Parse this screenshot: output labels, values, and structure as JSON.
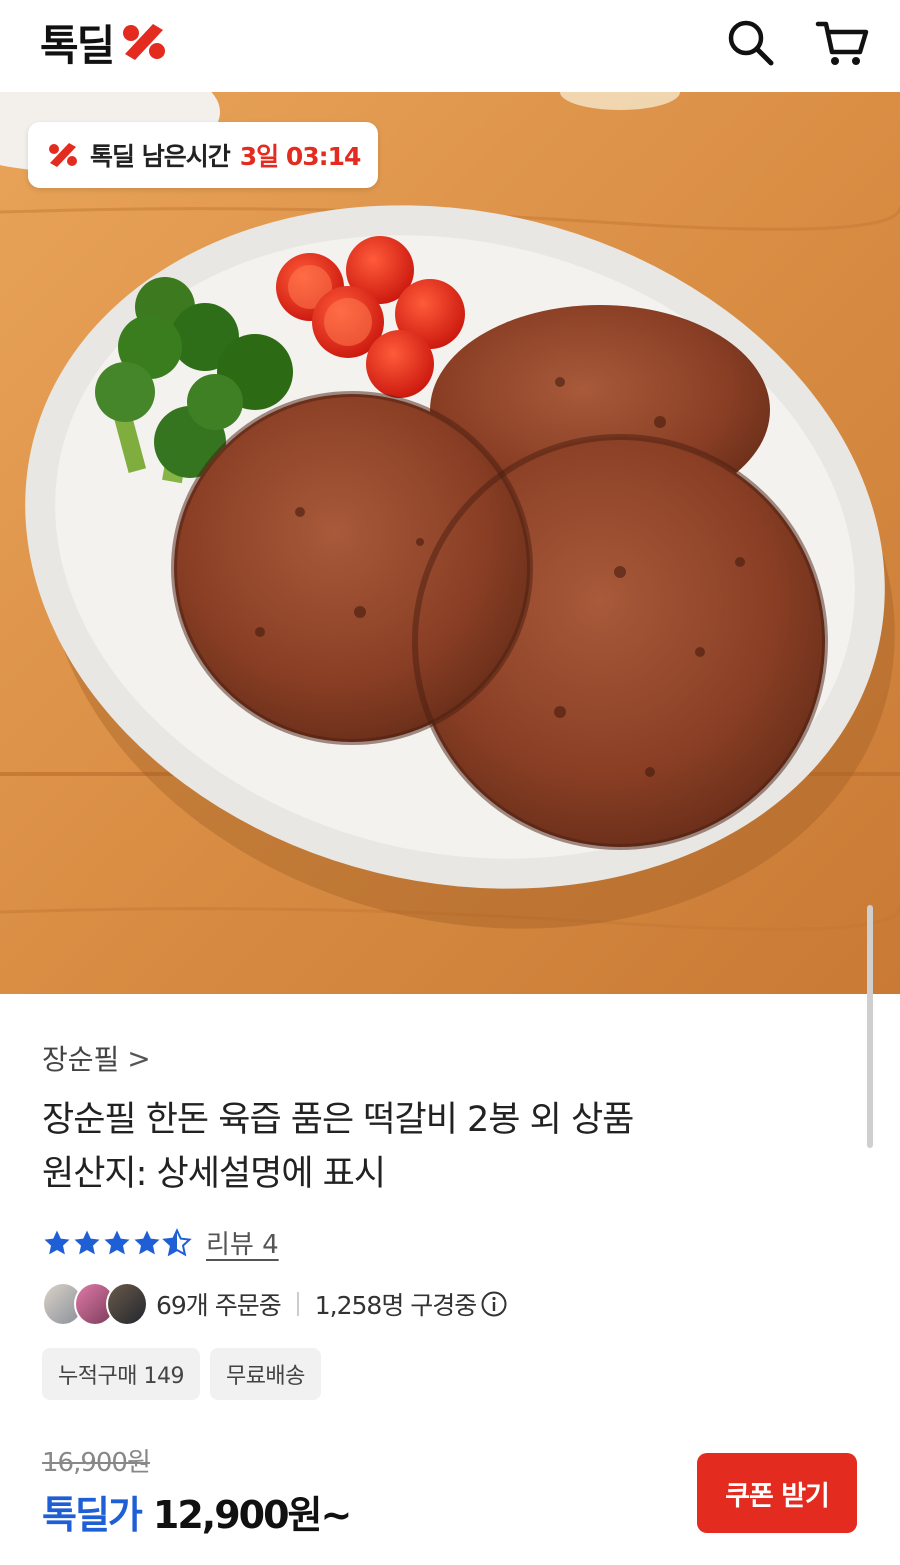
{
  "header": {
    "logo_text": "톡딜",
    "brand_color": "#e32b1f"
  },
  "hero": {
    "timer_label": "톡딜 남은시간",
    "timer_value": "3일 03:14"
  },
  "product": {
    "brand": "장순필",
    "brand_chevron": ">",
    "title": "장순필 한돈 육즙 품은 떡갈비 2봉 외 상품",
    "origin": "원산지: 상세설명에 표시",
    "rating": 4.5,
    "review_label": "리뷰 4",
    "order_count": "69개 주문중",
    "viewer_count": "1,258명 구경중",
    "tags": [
      "누적구매 149",
      "무료배송"
    ],
    "original_price": "16,900원",
    "deal_label": "톡딜가",
    "deal_price": "12,900원~",
    "coupon_button": "쿠폰 받기",
    "accent_blue": "#1f5fd6",
    "star_color": "#1f5fd6"
  }
}
